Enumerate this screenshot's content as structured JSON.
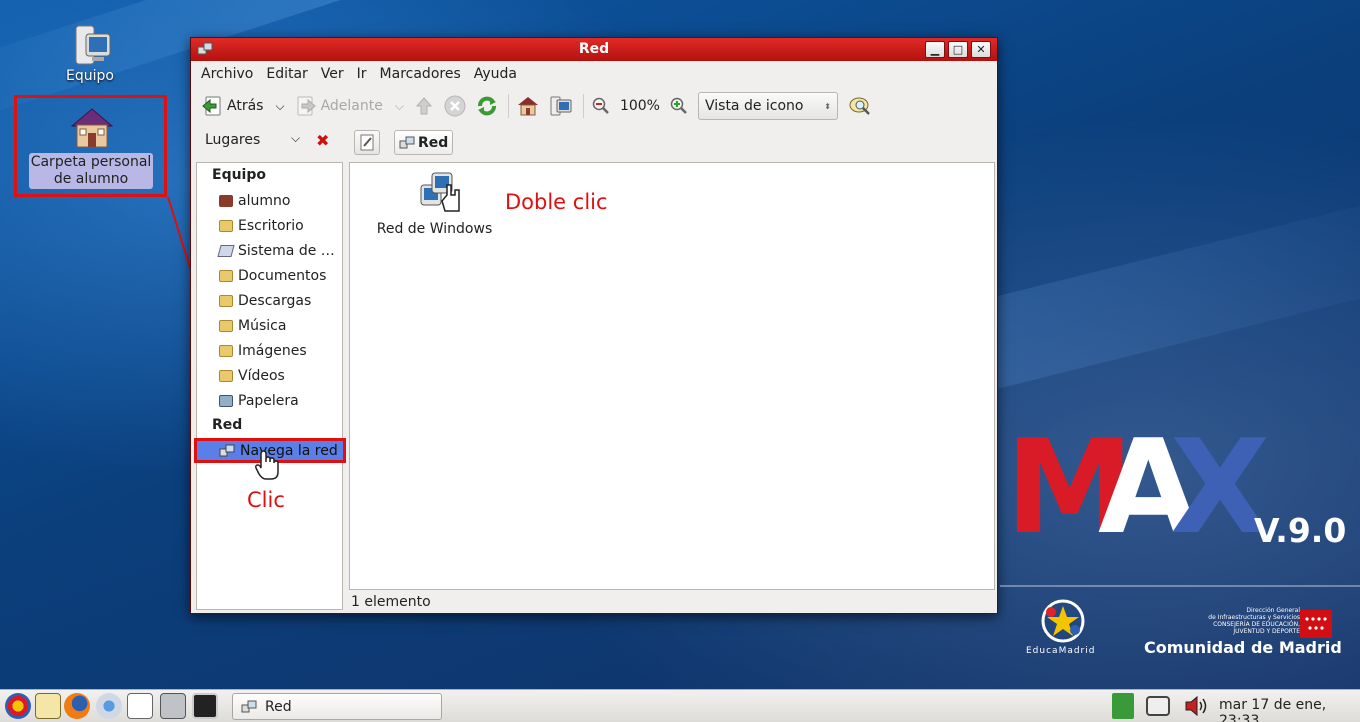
{
  "desktop": {
    "icons": [
      {
        "label": "Equipo"
      },
      {
        "label": "Carpeta personal de alumno"
      }
    ]
  },
  "window": {
    "title": "Red",
    "menu": [
      "Archivo",
      "Editar",
      "Ver",
      "Ir",
      "Marcadores",
      "Ayuda"
    ],
    "toolbar": {
      "back_label": "Atrás",
      "forward_label": "Adelante",
      "zoom_level": "100%",
      "view_mode": "Vista de icono"
    },
    "location": {
      "places_label": "Lugares",
      "crumb": "Red"
    },
    "sidebar": {
      "equipo_heading": "Equipo",
      "equipo_items": [
        "alumno",
        "Escritorio",
        "Sistema de …",
        "Documentos",
        "Descargas",
        "Música",
        "Imágenes",
        "Vídeos",
        "Papelera"
      ],
      "red_heading": "Red",
      "red_items": [
        "Navega la red"
      ]
    },
    "content": {
      "items": [
        {
          "label": "Red de Windows"
        }
      ]
    },
    "status": "1 elemento"
  },
  "annotations": {
    "double_click": "Doble clic",
    "click": "Clic"
  },
  "branding": {
    "max_letters": [
      "M",
      "A",
      "X"
    ],
    "version": "V.9.0",
    "educa": "EducaMadrid",
    "cm_small": [
      "Dirección General",
      "de Infraestructuras y Servicios",
      "CONSEJERÍA DE EDUCACIÓN,",
      "JUVENTUD Y DEPORTE"
    ],
    "cm_big": "Comunidad de Madrid"
  },
  "taskbar": {
    "task_label": "Red",
    "clock": "mar 17 de ene, 23:33"
  },
  "colors": {
    "title_red": "#c81614",
    "annotation_red": "#e01010",
    "selection_blue": "#5a7fe8",
    "max_m": "#d81b26",
    "max_a": "#ffffff",
    "max_x": "#3f61b5"
  }
}
